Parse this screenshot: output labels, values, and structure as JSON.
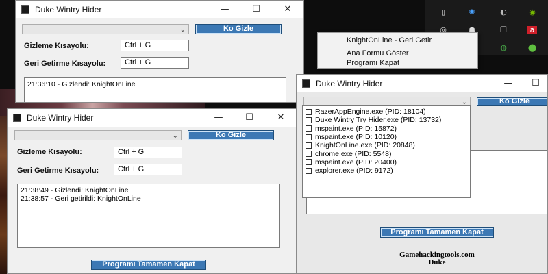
{
  "colors": {
    "button_blue": "#3c78b4",
    "desktop_dark": "#0d0d0d",
    "window_bg": "#f0f0f0"
  },
  "window_back_left": {
    "title": "Duke Wintry Hider",
    "hide_button": "Ko Gizle",
    "hide_shortcut_label": "Gizleme Kısayolu:",
    "hide_shortcut_value": "Ctrl + G",
    "restore_shortcut_label": "Geri Getirme Kısayolu:",
    "restore_shortcut_value": "Ctrl + G",
    "log": [
      "21:36:10 - Gizlendi: KnightOnLine"
    ]
  },
  "window_front_left": {
    "title": "Duke Wintry Hider",
    "hide_button": "Ko Gizle",
    "hide_shortcut_label": "Gizleme Kısayolu:",
    "hide_shortcut_value": "Ctrl + G",
    "restore_shortcut_label": "Geri Getirme Kısayolu:",
    "restore_shortcut_value": "Ctrl + G",
    "log": [
      "21:38:49 - Gizlendi: KnightOnLine",
      "21:38:57 - Geri getirildi: KnightOnLine"
    ],
    "quit_button": "Programı Tamamen Kapat"
  },
  "window_right": {
    "title": "Duke Wintry Hider",
    "hide_button": "Ko Gizle",
    "process_list": [
      "RazerAppEngine.exe (PID: 18104)",
      "Duke Wintry Try Hider.exe (PID: 13732)",
      "mspaint.exe (PID: 15872)",
      "mspaint.exe (PID: 10120)",
      "KnightOnLine.exe (PID: 20848)",
      "chrome.exe (PID: 5548)",
      "mspaint.exe (PID: 20400)",
      "explorer.exe (PID: 9172)"
    ],
    "quit_button": "Programı Tamamen Kapat"
  },
  "context_menu": {
    "items": [
      "KnightOnLine - Geri Getir",
      "Ana Formu Göster",
      "Programı Kapat"
    ]
  },
  "watermark": {
    "line1": "Gamehackingtools.com",
    "line2": "Duke"
  },
  "tray_icons": [
    "usb-drive-icon",
    "colorful-app-icon",
    "razer-icon",
    "nvidia-icon",
    "webcam-icon",
    "network-icon",
    "window-icon",
    "amd-icon",
    "settings-icon",
    "green-app-icon"
  ]
}
